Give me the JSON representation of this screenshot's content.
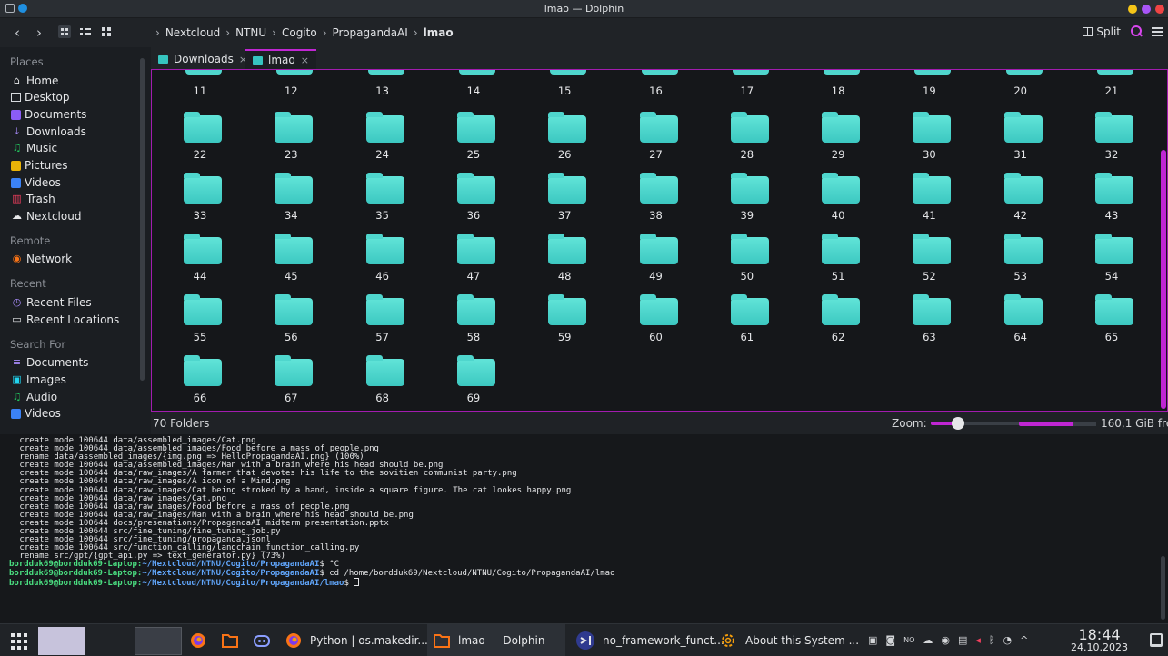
{
  "window": {
    "title": "lmao — Dolphin"
  },
  "colors": {
    "accent": "#c026d3",
    "folder": "#4fd6cd",
    "prompt_user": "#4ade80",
    "prompt_path": "#60a5fa"
  },
  "toolbar": {
    "breadcrumb": [
      "Nextcloud",
      "NTNU",
      "Cogito",
      "PropagandaAI",
      "lmao"
    ],
    "split_label": "Split"
  },
  "sidebar": {
    "places_heading": "Places",
    "places": [
      {
        "label": "Home",
        "icon": "home-icon"
      },
      {
        "label": "Desktop",
        "icon": "desktop-icon"
      },
      {
        "label": "Documents",
        "icon": "documents-icon"
      },
      {
        "label": "Downloads",
        "icon": "downloads-icon"
      },
      {
        "label": "Music",
        "icon": "music-icon"
      },
      {
        "label": "Pictures",
        "icon": "pictures-icon"
      },
      {
        "label": "Videos",
        "icon": "videos-icon"
      },
      {
        "label": "Trash",
        "icon": "trash-icon"
      },
      {
        "label": "Nextcloud",
        "icon": "cloud-icon"
      }
    ],
    "remote_heading": "Remote",
    "remote": [
      {
        "label": "Network",
        "icon": "network-icon"
      }
    ],
    "recent_heading": "Recent",
    "recent": [
      {
        "label": "Recent Files",
        "icon": "recent-files-icon"
      },
      {
        "label": "Recent Locations",
        "icon": "recent-locations-icon"
      }
    ],
    "search_heading": "Search For",
    "search": [
      {
        "label": "Documents",
        "icon": "documents-search-icon"
      },
      {
        "label": "Images",
        "icon": "images-icon"
      },
      {
        "label": "Audio",
        "icon": "audio-icon"
      },
      {
        "label": "Videos",
        "icon": "videos-search-icon"
      }
    ]
  },
  "tabs": [
    {
      "label": "Downloads",
      "close": "×"
    },
    {
      "label": "lmao",
      "close": "×"
    }
  ],
  "folders": {
    "partial_row": [
      "11",
      "12",
      "13",
      "14",
      "15",
      "16",
      "17",
      "18",
      "19",
      "20",
      "21"
    ],
    "items": [
      "22",
      "23",
      "24",
      "25",
      "26",
      "27",
      "28",
      "29",
      "30",
      "31",
      "32",
      "33",
      "34",
      "35",
      "36",
      "37",
      "38",
      "39",
      "40",
      "41",
      "42",
      "43",
      "44",
      "45",
      "46",
      "47",
      "48",
      "49",
      "50",
      "51",
      "52",
      "53",
      "54",
      "55",
      "56",
      "57",
      "58",
      "59",
      "60",
      "61",
      "62",
      "63",
      "64",
      "65",
      "66",
      "67",
      "68",
      "69"
    ]
  },
  "status": {
    "count": "70 Folders",
    "zoom_label": "Zoom:",
    "zoom_level": 0.3,
    "free_space": "160,1 GiB free",
    "disk_used_fraction": 0.7
  },
  "terminal": {
    "lines": [
      " create mode 100644 data/assembled_images/Cat.png",
      " create mode 100644 data/assembled_images/Food before a mass of people.png",
      " rename data/assembled_images/{img.png => HelloPropagandaAI.png} (100%)",
      " create mode 100644 data/assembled_images/Man with a brain where his head should be.png",
      " create mode 100644 data/raw_images/A farmer that devotes his life to the sovitien communist party.png",
      " create mode 100644 data/raw_images/A icon of a Mind.png",
      " create mode 100644 data/raw_images/Cat being stroked by a hand, inside a square figure. The cat lookes happy.png",
      " create mode 100644 data/raw_images/Cat.png",
      " create mode 100644 data/raw_images/Food before a mass of people.png",
      " create mode 100644 data/raw_images/Man with a brain where his head should be.png",
      " create mode 100644 docs/presenations/PropagandaAI midterm presentation.pptx",
      " create mode 100644 src/fine_tuning/fine_tuning_job.py",
      " create mode 100644 src/fine_tuning/propaganda.jsonl",
      " create mode 100644 src/function_calling/langchain_function_calling.py",
      " rename src/gpt/{gpt_api.py => text_generator.py} (73%)"
    ],
    "prompts": [
      {
        "user": "bordduk69@bordduk69-Laptop",
        "path": "~/Nextcloud/NTNU/Cogito/PropagandaAI",
        "cmd": "^C"
      },
      {
        "user": "bordduk69@bordduk69-Laptop",
        "path": "~/Nextcloud/NTNU/Cogito/PropagandaAI",
        "cmd": "cd /home/bordduk69/Nextcloud/NTNU/Cogito/PropagandaAI/lmao"
      },
      {
        "user": "bordduk69@bordduk69-Laptop",
        "path": "~/Nextcloud/NTNU/Cogito/PropagandaAI/lmao",
        "cmd": ""
      }
    ]
  },
  "taskbar": {
    "tasks": [
      {
        "label": "Python | os.makedir...",
        "icon": "firefox-icon"
      },
      {
        "label": "lmao — Dolphin",
        "icon": "dolphin-icon"
      },
      {
        "label": "no_framework_funct...",
        "icon": "vscode-icon"
      },
      {
        "label": "About this System ...",
        "icon": "settings-icon"
      }
    ],
    "tray_no": "NO",
    "time": "18:44",
    "date": "24.10.2023"
  }
}
